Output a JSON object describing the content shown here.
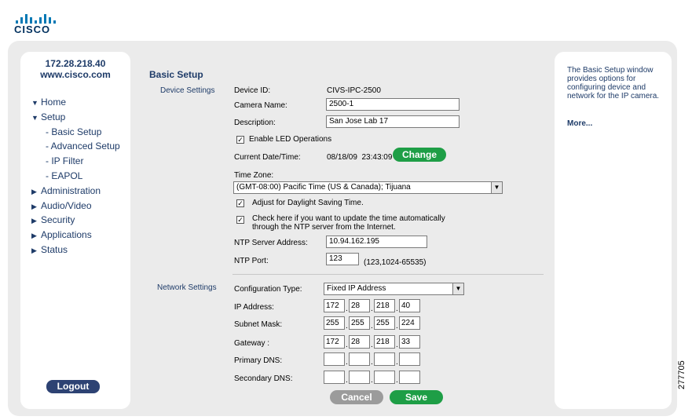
{
  "brand": {
    "logo_text": "CISCO"
  },
  "left_panel": {
    "ip": "172.28.218.40",
    "host": "www.cisco.com",
    "nav": [
      {
        "label": "Home",
        "expanded": true
      },
      {
        "label": "Setup",
        "expanded": true
      },
      {
        "label": "- Basic Setup",
        "sub": true
      },
      {
        "label": "- Advanced Setup",
        "sub": true
      },
      {
        "label": "- IP Filter",
        "sub": true
      },
      {
        "label": "- EAPOL",
        "sub": true
      },
      {
        "label": "Administration",
        "expanded": false
      },
      {
        "label": "Audio/Video",
        "expanded": false
      },
      {
        "label": "Security",
        "expanded": false
      },
      {
        "label": "Applications",
        "expanded": false
      },
      {
        "label": "Status",
        "expanded": false
      }
    ],
    "logout_label": "Logout"
  },
  "main": {
    "title": "Basic Setup",
    "device_settings": {
      "section_label": "Device Settings",
      "device_id_label": "Device ID:",
      "device_id_value": "CIVS-IPC-2500",
      "camera_name_label": "Camera Name:",
      "camera_name_value": "2500-1",
      "description_label": "Description:",
      "description_value": "San Jose Lab 17",
      "enable_led_label": "Enable LED Operations",
      "current_datetime_label": "Current Date/Time:",
      "current_datetime_value": "08/18/09  23:43:09",
      "change_label": "Change",
      "time_zone_label": "Time Zone:",
      "time_zone_value": "(GMT-08:00) Pacific Time (US & Canada); Tijuana",
      "dst_label": "Adjust for Daylight Saving Time.",
      "ntp_auto_label_line1": "Check here if you want to update the time automatically",
      "ntp_auto_label_line2": "through the NTP server from the Internet.",
      "ntp_server_label": "NTP Server Address:",
      "ntp_server_value": "10.94.162.195",
      "ntp_port_label": "NTP Port:",
      "ntp_port_value": "123",
      "ntp_port_hint": "(123,1024-65535)"
    },
    "network_settings": {
      "section_label": "Network Settings",
      "config_type_label": "Configuration Type:",
      "config_type_value": "Fixed IP Address",
      "ip_label": "IP Address:",
      "ip_value": [
        "172",
        "28",
        "218",
        "40"
      ],
      "subnet_label": "Subnet Mask:",
      "subnet_value": [
        "255",
        "255",
        "255",
        "224"
      ],
      "gateway_label": "Gateway :",
      "gateway_value": [
        "172",
        "28",
        "218",
        "33"
      ],
      "dns1_label": "Primary DNS:",
      "dns1_value": [
        "",
        "",
        "",
        ""
      ],
      "dns2_label": "Secondary DNS:",
      "dns2_value": [
        "",
        "",
        "",
        ""
      ]
    },
    "cancel_label": "Cancel",
    "save_label": "Save"
  },
  "right_panel": {
    "help_text": "The Basic Setup window provides options for configuring device and network for the IP camera.",
    "more_label": "More..."
  },
  "figure_number": "277705"
}
